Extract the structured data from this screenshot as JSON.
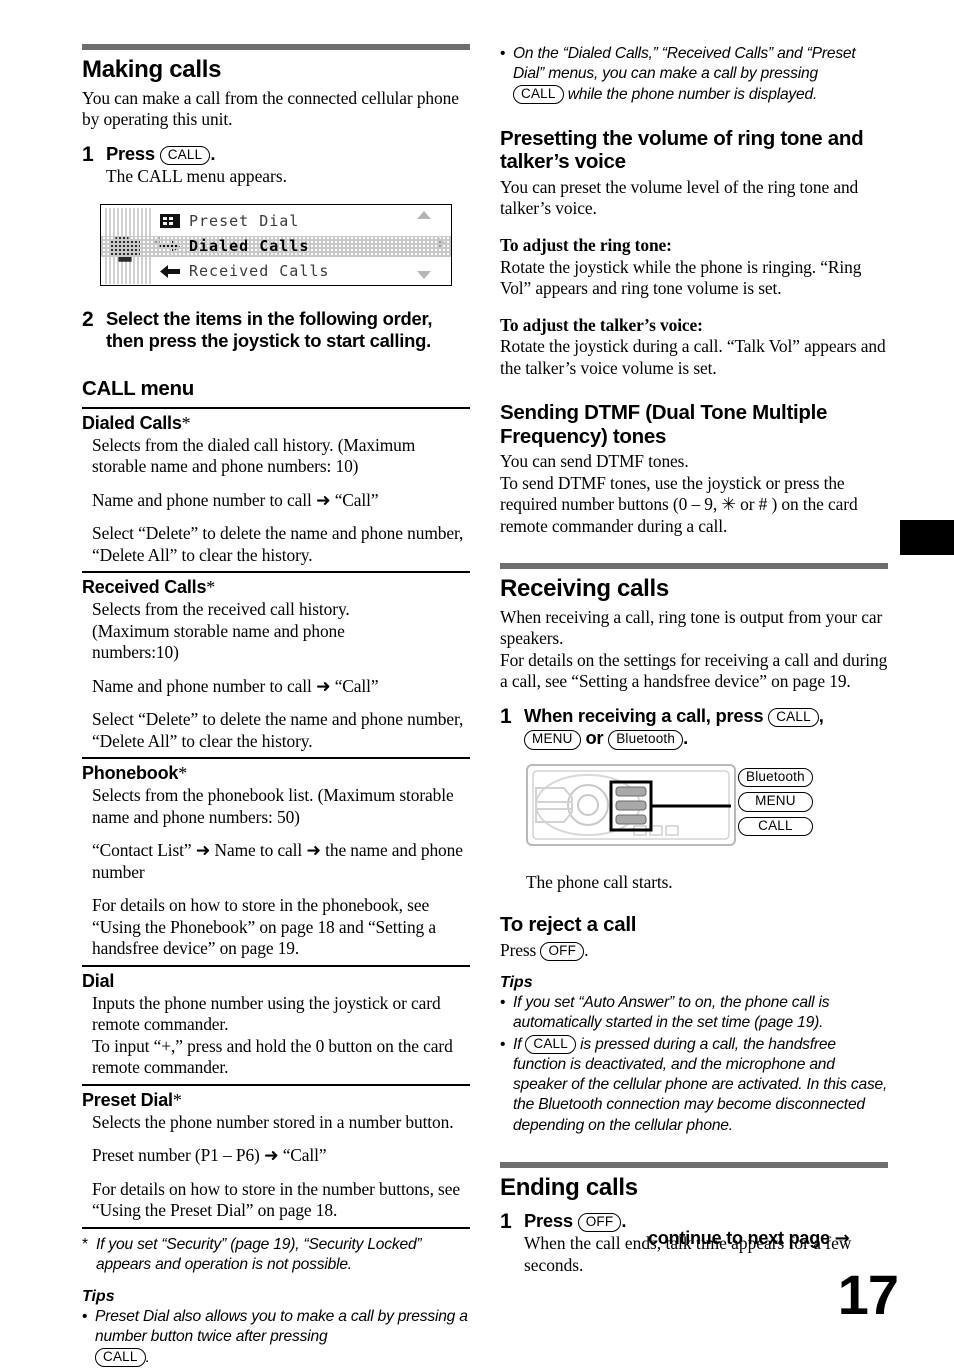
{
  "page": {
    "number": "17",
    "continue_label": "continue to next page",
    "continue_arrow": "→"
  },
  "keys": {
    "call": "CALL",
    "menu": "MENU",
    "bluetooth": "Bluetooth",
    "off": "OFF"
  },
  "left_column": {
    "making_calls": {
      "heading": "Making calls",
      "intro": "You can make a call from the connected cellular phone by operating this unit.",
      "step1": {
        "number": "1",
        "head_before": "Press",
        "head_after": ".",
        "sub": "The CALL menu appears."
      },
      "lcd": {
        "rows": [
          {
            "label": "Preset Dial",
            "selected": false,
            "icon": "preset-dial-icon"
          },
          {
            "label": "Dialed Calls",
            "selected": true,
            "icon": "dialed-calls-icon"
          },
          {
            "label": "Received Calls",
            "selected": false,
            "icon": "received-calls-icon"
          }
        ]
      },
      "step2": {
        "number": "2",
        "head": "Select the items in the following order, then press the joystick to start calling."
      }
    },
    "call_menu": {
      "heading": "CALL menu",
      "entries": [
        {
          "title": "Dialed Calls",
          "star": "*",
          "paras": [
            "Selects from the dialed call history. (Maximum storable name and phone numbers: 10)",
            "Name and phone number to call ➜ “Call”",
            "Select “Delete” to delete the name and phone number, “Delete All” to clear the history."
          ]
        },
        {
          "title": "Received Calls",
          "star": "*",
          "paras": [
            "Selects from the received call history. (Maximum storable name and phone numbers:10)",
            "Name and phone number to call ➜ “Call”",
            "Select “Delete” to delete the name and phone number, “Delete All” to clear the history."
          ]
        },
        {
          "title": "Phonebook",
          "star": "*",
          "paras": [
            "Selects from the phonebook list. (Maximum storable name and phone numbers: 50)",
            "“Contact List” ➜ Name to call ➜ the name and phone number",
            "For details on how to store in the phonebook, see “Using the Phonebook” on page 18 and “Setting a handsfree device” on page 19."
          ]
        },
        {
          "title": "Dial",
          "star": "",
          "paras": [
            "Inputs the phone number using the joystick or card remote commander.\nTo input “+,” press and hold the 0 button on the card remote commander."
          ]
        },
        {
          "title": "Preset Dial",
          "star": "*",
          "paras": [
            "Selects the phone number stored in a number button.",
            "Preset number (P1 – P6) ➜ “Call”",
            "For details on how to store in the number buttons, see “Using the Preset Dial” on page 18."
          ]
        }
      ],
      "footnote_mark": "*",
      "footnote": "If you set “Security” (page 19), “Security Locked” appears and operation is not possible.",
      "tips_heading": "Tips",
      "tip_bullet": "•",
      "tip1_part1": "Preset Dial also allows you to make a call by pressing a number button twice after pressing",
      "tip1_part2": "."
    }
  },
  "right_column": {
    "top_tip": {
      "bullet": "•",
      "part1": "On the “Dialed Calls,” “Received Calls” and “Preset Dial” menus, you can make a call by pressing",
      "part2": "while the phone number is displayed."
    },
    "presetting_volume": {
      "heading": "Presetting the volume of ring tone and talker’s voice",
      "intro": "You can preset the volume level of the ring tone and talker’s voice.",
      "ring_tone_head": "To adjust the ring tone:",
      "ring_tone_body": "Rotate the joystick while the phone is ringing. “Ring Vol” appears and ring tone volume is set.",
      "talker_head": "To adjust the talker’s voice:",
      "talker_body": "Rotate the joystick during a call. “Talk Vol” appears and the talker’s voice volume is set."
    },
    "dtmf": {
      "heading": "Sending DTMF (Dual Tone Multiple Frequency) tones",
      "body": "You can send DTMF tones.\nTo send DTMF tones, use the joystick or press the required number buttons (0 – 9, ✳ or # ) on the card remote commander during a call."
    },
    "receiving_calls": {
      "heading": "Receiving calls",
      "intro": "When receiving a call, ring tone is output from your car speakers.\nFor details on the settings for receiving a call and during a call, see “Setting a handsfree device” on page 19.",
      "step1": {
        "number": "1",
        "head_before": "When receiving a call, press",
        "head_mid": ",",
        "head_or": "or",
        "head_after": "."
      },
      "figure": {
        "callouts": [
          "Bluetooth",
          "MENU",
          "CALL"
        ]
      },
      "after_figure": "The phone call starts."
    },
    "reject_call": {
      "heading": "To reject a call",
      "press_label": "Press",
      "press_after": ".",
      "tips_heading": "Tips",
      "tip_bullet": "•",
      "tip1": "If you set “Auto Answer” to on, the phone call is automatically started in the set time (page 19).",
      "tip2_part1": "If",
      "tip2_part2": "is pressed during a call, the handsfree function is deactivated, and the microphone and speaker of the cellular phone are activated. In this case, the Bluetooth connection may become disconnected depending on the cellular phone."
    },
    "ending_calls": {
      "heading": "Ending calls",
      "step1": {
        "number": "1",
        "head_before": "Press",
        "head_after": ".",
        "sub": "When the call ends, talk time appears for a few seconds."
      }
    }
  }
}
